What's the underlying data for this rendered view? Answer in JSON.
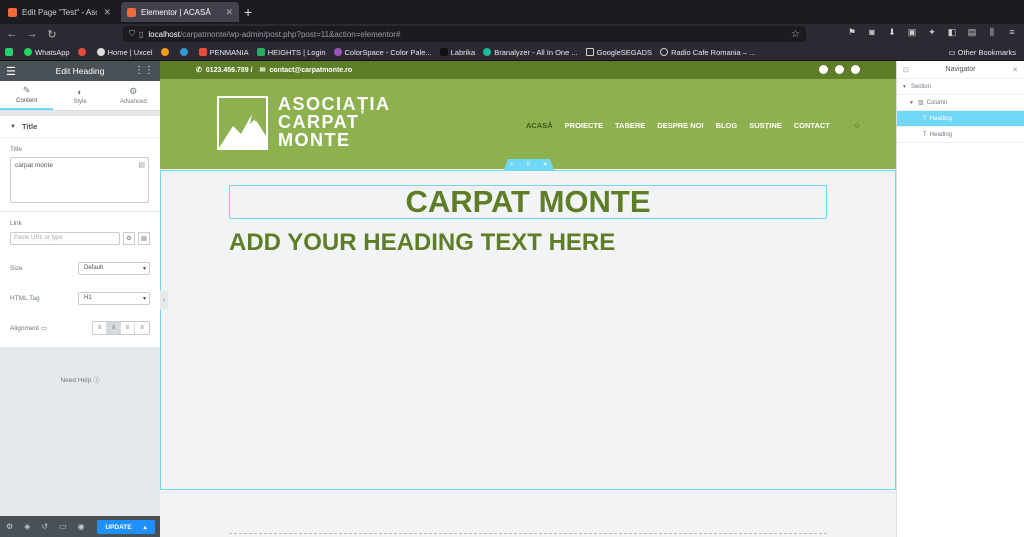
{
  "browser": {
    "tabs": [
      {
        "label": "Edit Page \"Test\" - Asociația C",
        "active": false
      },
      {
        "label": "Elementor | ACASĂ",
        "active": true
      }
    ],
    "url_host": "localhost",
    "url_path": "/carpatmonte/wp-admin/post.php?post=11&action=elementor#",
    "bookmarks": [
      "WhatsApp",
      "Home | Uxcel",
      "PENMANIA",
      "HEIGHTS | Login",
      "ColorSpace - Color Pale...",
      "Labrika",
      "Branalyzer - All In One ...",
      "GoogleSEGADS",
      "Radio Cafe Romania – ..."
    ],
    "other_bookmarks": "Other Bookmarks"
  },
  "panel": {
    "title": "Edit Heading",
    "tabs": [
      "Content",
      "Style",
      "Advanced"
    ],
    "section_title": "Title",
    "title_label": "Title",
    "title_value": "carpat monte",
    "link_label": "Link",
    "link_placeholder": "Paste URL or type",
    "size_label": "Size",
    "size_value": "Default",
    "html_tag_label": "HTML Tag",
    "html_tag_value": "H1",
    "alignment_label": "Alignment",
    "need_help": "Need Help",
    "update_label": "UPDATE"
  },
  "site": {
    "phone": "0123.456.789 /",
    "email": "contact@carpatmonte.ro",
    "logo_lines": [
      "ASOCIAȚIA",
      "CARPAT",
      "MONTE"
    ],
    "menu": [
      "ACASĂ",
      "PROIECTE",
      "TABERE",
      "DESPRE NOI",
      "BLOG",
      "SUSȚINE",
      "CONTACT"
    ],
    "heading_1": "CARPAT MONTE",
    "heading_2": "ADD YOUR HEADING TEXT HERE",
    "brand_green": "#5e7d27",
    "header_green": "#8db14f"
  },
  "navigator": {
    "title": "Navigator",
    "items": [
      {
        "label": "Section",
        "level": 0
      },
      {
        "label": "Column",
        "level": 1
      },
      {
        "label": "Heading",
        "level": 2,
        "selected": true
      },
      {
        "label": "Heading",
        "level": 2
      }
    ]
  }
}
